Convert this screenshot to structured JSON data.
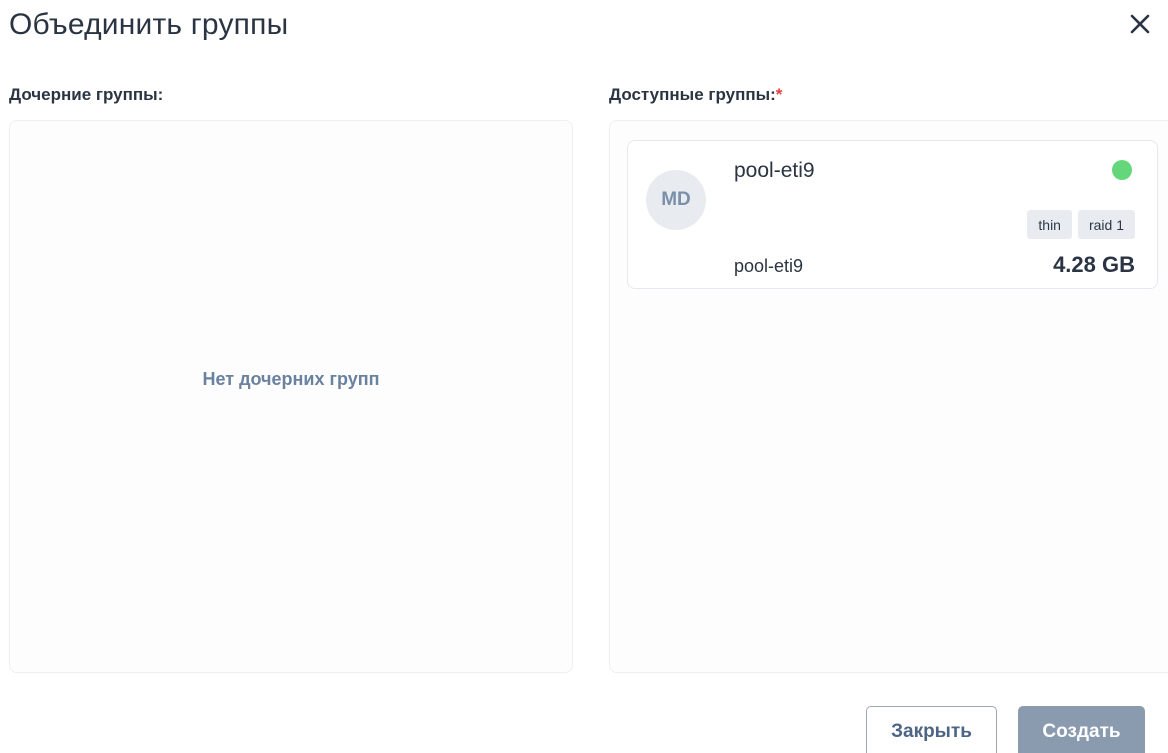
{
  "dialog": {
    "title": "Объединить группы",
    "close_icon": "close-icon"
  },
  "child_groups": {
    "label": "Дочерние группы:",
    "empty_text": "Нет дочерних групп"
  },
  "available_groups": {
    "label": "Доступные группы:",
    "required_mark": "*",
    "items": [
      {
        "avatar": "MD",
        "name": "pool-eti9",
        "status_color": "#64d77a",
        "tags": [
          "thin",
          "raid 1"
        ],
        "subtitle": "pool-eti9",
        "size": "4.28 GB"
      }
    ]
  },
  "footer": {
    "close_label": "Закрыть",
    "create_label": "Создать"
  },
  "colors": {
    "required": "#e53e3e",
    "status_online": "#64d77a",
    "create_button_disabled": "#8a9bb0",
    "empty_text": "#6a819f"
  }
}
